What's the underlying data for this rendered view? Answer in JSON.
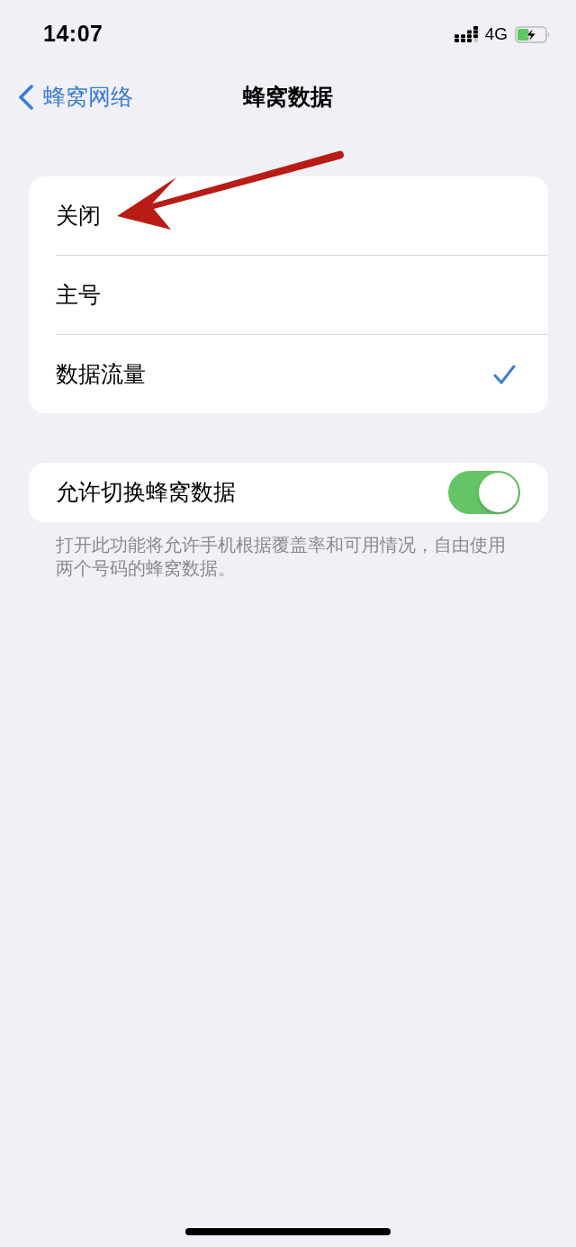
{
  "status_bar": {
    "time": "14:07",
    "network": "4G",
    "battery": {
      "level": 0.45,
      "charging": true
    }
  },
  "nav": {
    "back_label": "蜂窝网络",
    "title": "蜂窝数据"
  },
  "options": [
    {
      "label": "关闭",
      "selected": false
    },
    {
      "label": "主号",
      "selected": false
    },
    {
      "label": "数据流量",
      "selected": true
    }
  ],
  "switch_row": {
    "label": "允许切换蜂窝数据",
    "on": true
  },
  "footer": "打开此功能将允许手机根据覆盖率和可用情况，自由使用两个号码的蜂窝数据。"
}
